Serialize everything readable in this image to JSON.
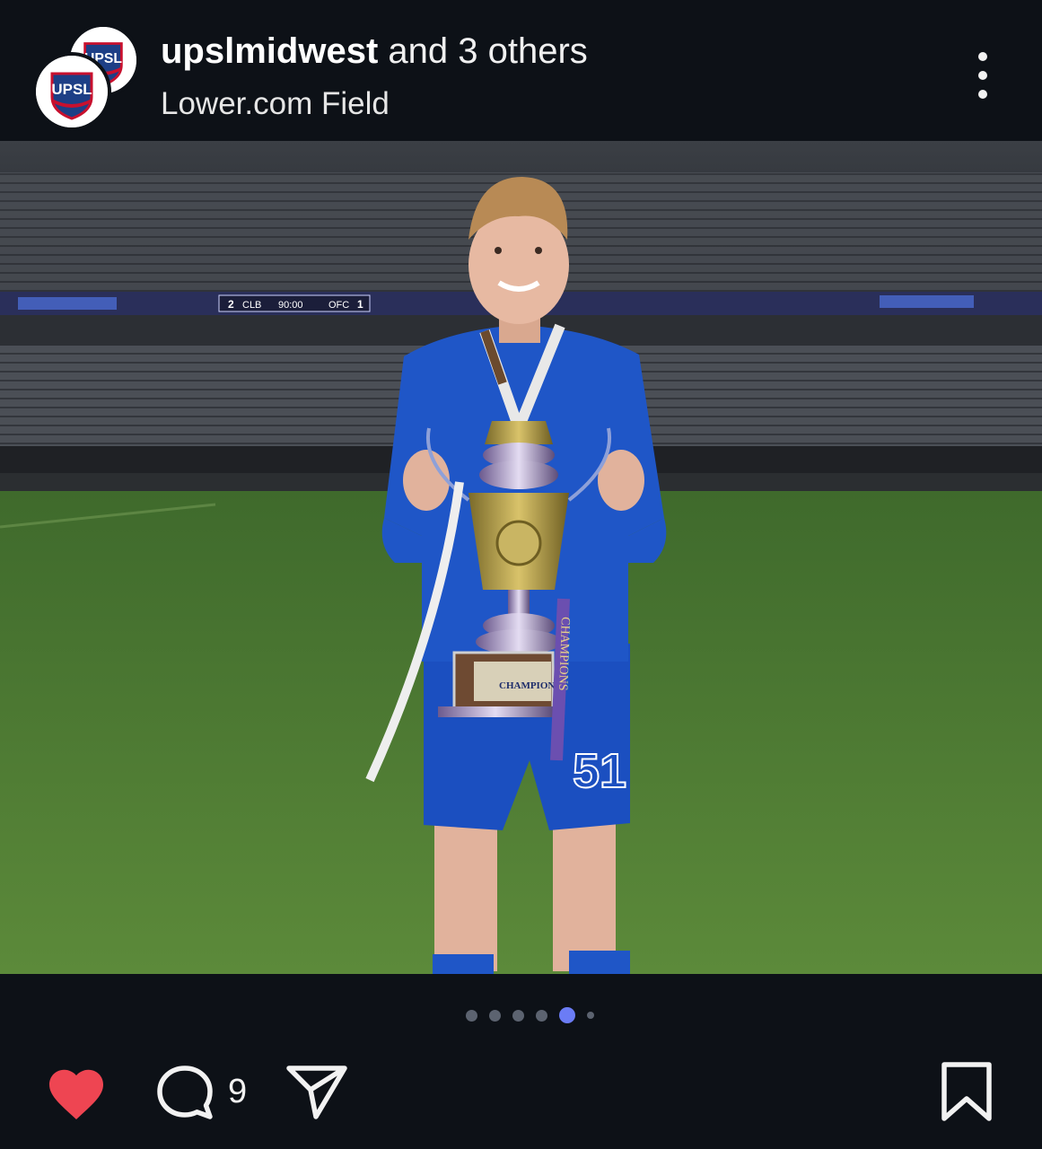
{
  "post": {
    "username": "upslmidwest",
    "collab_suffix": " and 3 others",
    "location": "Lower.com Field",
    "avatar_text": "UPSL",
    "more_icon": "more-vertical-icon"
  },
  "photo": {
    "scoreboard": {
      "home_score": "2",
      "home_team": "CLB",
      "away_team": "OFC",
      "away_score": "1",
      "clock": "90:00"
    },
    "jersey_number": "51",
    "trophy_plaque": "CHAMPION",
    "ribbon_text": "CHAMPIONS"
  },
  "carousel": {
    "total": 6,
    "active_index": 4
  },
  "actions": {
    "liked": true,
    "like_color": "#ee4552",
    "comment_count": "9",
    "icons": [
      "heart-icon",
      "comment-icon",
      "share-icon",
      "bookmark-icon"
    ]
  },
  "colors": {
    "background": "#0d1117",
    "accent_dot": "#6b7cf5",
    "jersey_blue": "#1f56c7"
  }
}
